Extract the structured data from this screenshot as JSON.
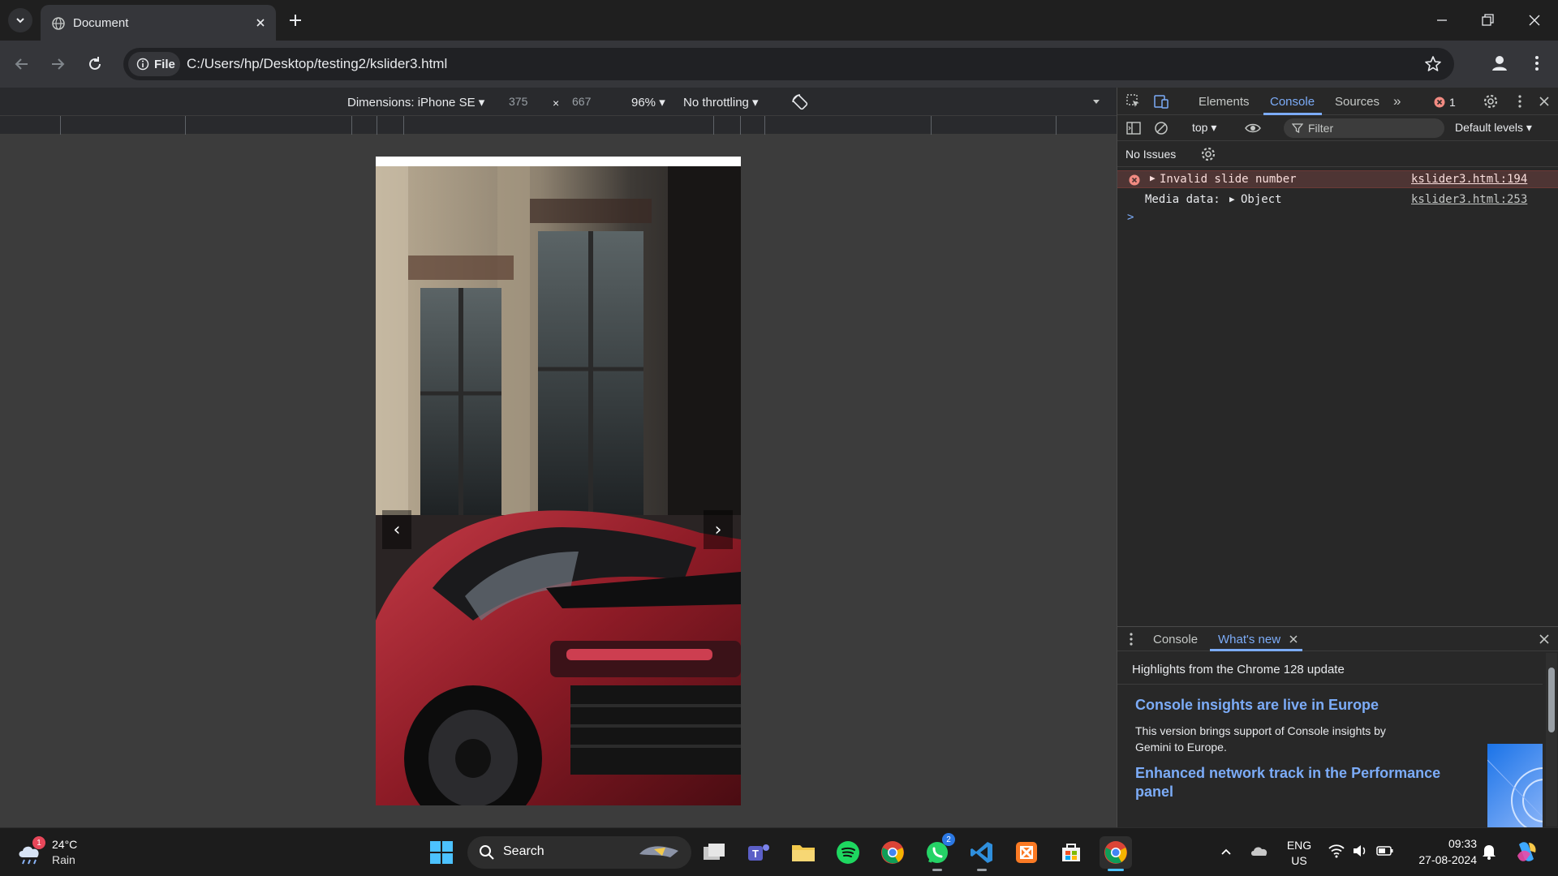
{
  "browser": {
    "tab": {
      "title": "Document",
      "icon": "globe-icon"
    },
    "address": {
      "chip_label": "File",
      "url": "C:/Users/hp/Desktop/testing2/kslider3.html"
    }
  },
  "device_toolbar": {
    "dimensions_label": "Dimensions: iPhone SE",
    "width": "375",
    "times": "×",
    "height": "667",
    "zoom": "96%",
    "throttling": "No throttling"
  },
  "page": {
    "prev_arrow": "‹",
    "next_arrow": "›",
    "slide_subject": "red sports car parked in front of a classic building"
  },
  "devtools": {
    "tabs": [
      "Elements",
      "Console",
      "Sources"
    ],
    "active_tab": "Console",
    "more_tabs": "»",
    "error_count": "1",
    "context": "top",
    "filter_placeholder": "Filter",
    "levels": "Default levels",
    "issues": "No Issues",
    "messages": [
      {
        "type": "error",
        "text": "Invalid slide number",
        "source": "kslider3.html:194"
      },
      {
        "type": "log",
        "label": "Media data:",
        "value": "Object",
        "source": "kslider3.html:253"
      }
    ],
    "prompt": ">",
    "drawer": {
      "tabs": [
        "Console",
        "What's new"
      ],
      "active_tab": "What's new",
      "heading": "Highlights from the Chrome 128 update",
      "items": [
        {
          "title": "Console insights are live in Europe",
          "body": "This version brings support of Console insights by Gemini to Europe."
        },
        {
          "title": "Enhanced network track in the Performance panel",
          "body": ""
        }
      ]
    }
  },
  "taskbar": {
    "weather": {
      "temp": "24°C",
      "condition": "Rain",
      "badge": "1"
    },
    "search_label": "Search",
    "whatsapp_badge": "2",
    "language": {
      "lang": "ENG",
      "region": "US"
    },
    "clock": {
      "time": "09:33",
      "date": "27-08-2024"
    }
  },
  "colors": {
    "accent": "#7cacf8",
    "error_bg": "#4e3534",
    "error_icon": "#f28b82"
  }
}
